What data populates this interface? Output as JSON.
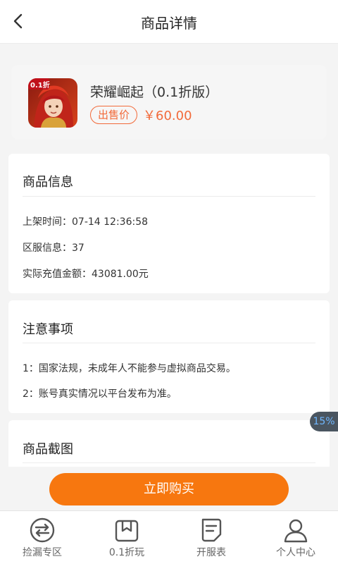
{
  "header": {
    "title": "商品详情",
    "back_icon": "chevron-left-icon"
  },
  "product": {
    "name": "荣耀崛起（0.1折版）",
    "thumbnail_badge": "0.1折",
    "sale_tag": "出售价",
    "price": "￥60.00",
    "accent_color": "#f26a3a"
  },
  "info": {
    "title": "商品信息",
    "list_time": "上架时间：07-14 12:36:58",
    "server": "区服信息：37",
    "recharge": "实际充值金额：43081.00元"
  },
  "notice": {
    "title": "注意事项",
    "items": [
      "1：国家法规，未成年人不能参与虚拟商品交易。",
      "2：账号真实情况以平台发布为准。"
    ]
  },
  "screenshots": {
    "title": "商品截图"
  },
  "float_badge": "15%",
  "buy_button": {
    "label": "立即购买",
    "color": "#f7770f"
  },
  "tabbar": {
    "items": [
      {
        "label": "捡漏专区",
        "icon": "swap-arrows-icon"
      },
      {
        "label": "0.1折玩",
        "icon": "gift-box-icon"
      },
      {
        "label": "开服表",
        "icon": "document-list-icon"
      },
      {
        "label": "个人中心",
        "icon": "user-icon"
      }
    ]
  }
}
